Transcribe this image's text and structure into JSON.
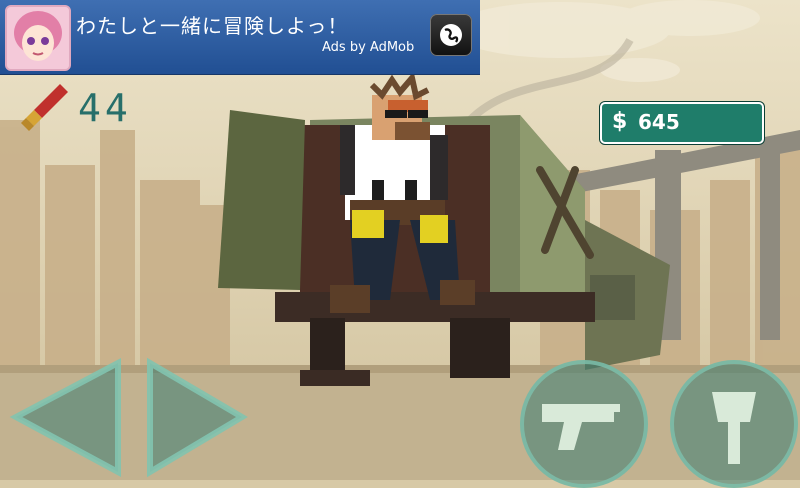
{
  "ad_banner": {
    "title": "わたしと一緒に冒険しよっ！",
    "provider_text": "Ads by AdMob"
  },
  "hud": {
    "ammo_count": "44",
    "money_currency_symbol": "$",
    "money_value": "645"
  },
  "controls": {
    "left_icon": "triangle-left-icon",
    "right_icon": "triangle-right-icon",
    "fire_icon": "pistol-icon",
    "melee_icon": "axe-icon"
  },
  "colors": {
    "ad_blue": "#2f5fa4",
    "hud_teal": "#276f6a",
    "money_green": "#1f7d6a",
    "control_teal": "#3c7e72"
  }
}
